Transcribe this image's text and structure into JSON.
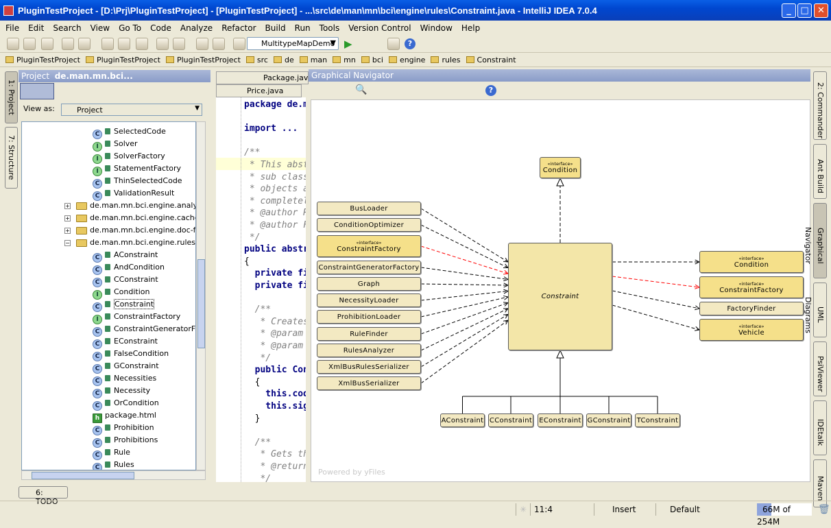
{
  "window": {
    "title": "PluginTestProject - [D:\\Prj\\PluginTestProject] - [PluginTestProject] - ...\\src\\de\\man\\mn\\bci\\engine\\rules\\Constraint.java - IntelliJ IDEA 7.0.4",
    "min": "_",
    "max": "□",
    "close": "✕"
  },
  "menu": [
    "File",
    "Edit",
    "Search",
    "View",
    "Go To",
    "Code",
    "Analyze",
    "Refactor",
    "Build",
    "Run",
    "Tools",
    "Version Control",
    "Window",
    "Help"
  ],
  "toolbar": {
    "run_config": "MultitypeMapDemo"
  },
  "breadcrumbs": [
    "PluginTestProject",
    "PluginTestProject",
    "PluginTestProject",
    "src",
    "de",
    "man",
    "mn",
    "bci",
    "engine",
    "rules",
    "Constraint"
  ],
  "left_tabs": [
    "1: Project",
    "7: Structure"
  ],
  "right_tabs": [
    "2: Commander",
    "Ant Build",
    "Graphical Navigator",
    "UML Diagrams",
    "PsiViewer",
    "IDEtalk",
    "Maven"
  ],
  "project_panel": {
    "title": "Project",
    "subtitle": "de.man.mn.bci...",
    "view_as_label": "View as:",
    "view_as_value": "Project",
    "items": [
      {
        "label": "SelectedCode",
        "icon": "abstract-class"
      },
      {
        "label": "Solver",
        "icon": "interface"
      },
      {
        "label": "SolverFactory",
        "icon": "interface"
      },
      {
        "label": "StatementFactory",
        "icon": "interface"
      },
      {
        "label": "ThinSelectedCode",
        "icon": "class"
      },
      {
        "label": "ValidationResult",
        "icon": "class"
      },
      {
        "label": "de.man.mn.bci.engine.analyzer",
        "icon": "package"
      },
      {
        "label": "de.man.mn.bci.engine.cache",
        "icon": "package"
      },
      {
        "label": "de.man.mn.bci.engine.doc-files",
        "icon": "package"
      },
      {
        "label": "de.man.mn.bci.engine.rules",
        "icon": "package"
      },
      {
        "label": "AConstraint",
        "icon": "class"
      },
      {
        "label": "AndCondition",
        "icon": "class"
      },
      {
        "label": "CConstraint",
        "icon": "class"
      },
      {
        "label": "Condition",
        "icon": "interface"
      },
      {
        "label": "Constraint",
        "icon": "abstract-class"
      },
      {
        "label": "ConstraintFactory",
        "icon": "interface"
      },
      {
        "label": "ConstraintGeneratorFactory",
        "icon": "class"
      },
      {
        "label": "EConstraint",
        "icon": "class"
      },
      {
        "label": "FalseCondition",
        "icon": "class"
      },
      {
        "label": "GConstraint",
        "icon": "class"
      },
      {
        "label": "Necessities",
        "icon": "class"
      },
      {
        "label": "Necessity",
        "icon": "class"
      },
      {
        "label": "OrCondition",
        "icon": "class"
      },
      {
        "label": "package.html",
        "icon": "html"
      },
      {
        "label": "Prohibition",
        "icon": "class"
      },
      {
        "label": "Prohibitions",
        "icon": "class"
      },
      {
        "label": "Rule",
        "icon": "abstract-class"
      },
      {
        "label": "Rules",
        "icon": "class"
      }
    ]
  },
  "editor": {
    "tabs": [
      "Package.java",
      "Price.java"
    ],
    "lines": [
      {
        "t": "package de.ma",
        "k": "kw1"
      },
      {
        "t": ""
      },
      {
        "t": "import ...",
        "k": "imp"
      },
      {
        "t": ""
      },
      {
        "t": "/**",
        "k": "cm"
      },
      {
        "t": " * This abstr",
        "k": "cm"
      },
      {
        "t": " * sub classe",
        "k": "cm"
      },
      {
        "t": " * objects ar",
        "k": "cm"
      },
      {
        "t": " * completely",
        "k": "cm"
      },
      {
        "t": " * @author Ro",
        "k": "cm"
      },
      {
        "t": " * @author Fr",
        "k": "cm"
      },
      {
        "t": " */",
        "k": "cm"
      },
      {
        "t": "public abstra",
        "k": "kw"
      },
      {
        "t": "{"
      },
      {
        "t": "  private fin",
        "k": "kw"
      },
      {
        "t": "  private fin",
        "k": "kw"
      },
      {
        "t": ""
      },
      {
        "t": "  /**",
        "k": "cm"
      },
      {
        "t": "   * Creates",
        "k": "cm"
      },
      {
        "t": "   * @param c",
        "k": "cm"
      },
      {
        "t": "   * @param s",
        "k": "cm"
      },
      {
        "t": "   */",
        "k": "cm"
      },
      {
        "t": "  public Cons",
        "k": "kw1"
      },
      {
        "t": "  {"
      },
      {
        "t": "    this.code",
        "k": "kw1"
      },
      {
        "t": "    this.sign",
        "k": "kw1"
      },
      {
        "t": "  }"
      },
      {
        "t": ""
      },
      {
        "t": "  /**",
        "k": "cm"
      },
      {
        "t": "   * Gets the",
        "k": "cm"
      },
      {
        "t": "   * @return",
        "k": "cm"
      },
      {
        "t": "   */",
        "k": "cm"
      },
      {
        "t": "  public bool",
        "k": "kw"
      }
    ]
  },
  "navigator": {
    "title": "Graphical Navigator",
    "watermark": "Powered by yFiles",
    "stereotype": "«interface»",
    "center": "Constraint",
    "top": "Condition",
    "left": [
      "BusLoader",
      "ConditionOptimizer",
      "ConstraintFactory",
      "ConstraintGeneratorFactory",
      "Graph",
      "NecessityLoader",
      "ProhibitionLoader",
      "RuleFinder",
      "RulesAnalyzer",
      "XmlBusRulesSerializer",
      "XmlBusSerializer"
    ],
    "right": [
      "Condition",
      "ConstraintFactory",
      "FactoryFinder",
      "Vehicle"
    ],
    "bottom": [
      "AConstraint",
      "CConstraint",
      "EConstraint",
      "GConstraint",
      "TConstraint"
    ],
    "highlight_color": "#ff0000"
  },
  "bottom_tab": "6: TODO",
  "status": {
    "position": "11:4",
    "mode": "Insert",
    "profile": "Default",
    "memory": "66M of 254M",
    "memory_used_fraction": 0.26
  }
}
